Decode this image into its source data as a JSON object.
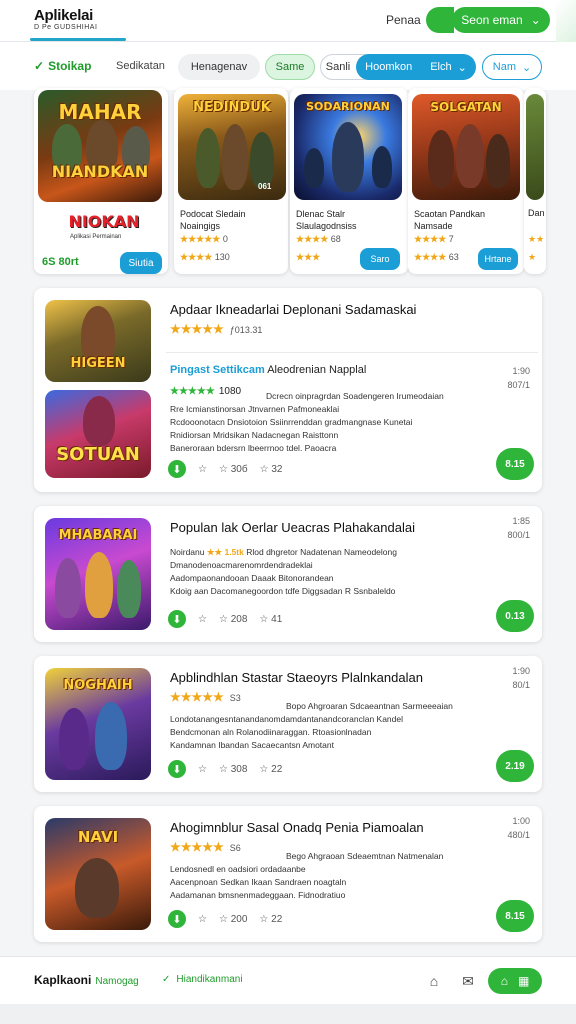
{
  "header": {
    "app_title": "Aplikelai",
    "app_subtitle": "D Pe GUDSHIHAI",
    "link": "Penaa",
    "cta_label": "Seon eman"
  },
  "filterbar": {
    "brand": "Stoikap",
    "text": "Sedikatan",
    "pills": [
      "Henagenav",
      "Same",
      "Sanli",
      "Hoomkon",
      "Elch",
      "Nam"
    ]
  },
  "featured": [
    {
      "art_title_top": "MAHAR",
      "art_title_bottom": "NIANDKAN",
      "logo": "NIOKAN",
      "logo_sub": "Aplikasi Permainan",
      "meta": "6S 80rt",
      "button": "Siutia"
    },
    {
      "art_title": "NEDINDUK",
      "name": "Podocat Sledain Noaingigs",
      "stars_a": "★★★★★",
      "stars_a_value": "0",
      "stars_b": "★★★★",
      "stars_b_value": "130",
      "badge": "061"
    },
    {
      "art_title": "SODARIONAN",
      "name": "Dlenac Stalr Slaulagodnsiss",
      "stars_a": "★★★★",
      "stars_a_value": "68",
      "stars_b": "★★★",
      "stars_b_value": "",
      "button": "Saro"
    },
    {
      "art_title": "SOLGATAN",
      "name": "Scaotan Pandkan Namsade",
      "stars_a": "★★★★",
      "stars_a_value": "7",
      "stars_b": "★★★★",
      "stars_b_value": "63",
      "button": "Hrtane"
    },
    {
      "name": "Dan",
      "stars_a": "★★",
      "stars_b": "★"
    }
  ],
  "list": [
    {
      "title": "Apdaar Ikneadarlai Deplonani Sadamaskai",
      "stars": "★★★★★",
      "stars_value": "ƒ013.31",
      "thumb_a_title": "HIGEEN",
      "thumb_b_title": "SOTUAN",
      "sub_title": "Pingast Settikcam",
      "sub_rest": "Aleodrenian Napplal",
      "sub2_stars": "★★★★★",
      "sub2_value": "1080",
      "desc": [
        "Dcrecn oinpragrdan Soadengeren Irumeodaian",
        "Rre Icmianstinorsan Jtnvarnen Pafmoneaklai",
        "Rcdooonotacn Dnsiotoion Ssiinrrenddan gradmangnase Kunetai",
        "Rnidiorsan Mridsikan Nadacnegan Raisttonn",
        "Baneroraan bdersrn lbeerrnoo tdel. Paoacra"
      ],
      "right_a": "1:90",
      "right_b": "807/1",
      "actions": [
        "☆",
        "30б",
        "32"
      ],
      "go": "8.15"
    },
    {
      "title": "Populan lak Oerlar Ueacras Plahakandalai",
      "stars": "★★ 1.5tk",
      "stars_value": "Rlod dhgretor Nadatenan Nameodelong",
      "lead": "Noirdanu",
      "thumb_title": "MHABARAI",
      "desc": [
        "Dmanodenoacmarenomrdendradeklai",
        "Aadompaonandooan Daaak Bitonorandean",
        "Kdoig aan Dacomanegoordon tdfe Diggsadan R Ssnbaleldo"
      ],
      "right_a": "1:85",
      "right_b": "800/1",
      "actions": [
        "☆",
        "208",
        "41"
      ],
      "go": "0.13"
    },
    {
      "title": "Apblindhlan Stastar Staeoyrs Plalnkandalan",
      "stars": "★★★★★",
      "stars_value": "S3",
      "thumb_title": "NOGHAIH",
      "desc": [
        "Bopo Ahgroaran Sdcaeantnan Sarmeeeaian",
        "Londotanangesntanandanomdamdantanandcoranclan Kandel",
        "Bendcmonan aln Rolanodiinaraggan. Rtoasionlnadan",
        "Kandamnan Ibandan Sacaecantsn Amotant"
      ],
      "right_a": "1:90",
      "right_b": "80/1",
      "actions": [
        "☆",
        "308",
        "22"
      ],
      "go": "2.19"
    },
    {
      "title": "Ahogimnblur Sasal Onadq Penia Piamoalan",
      "stars": "★★★★★",
      "stars_value": "S6",
      "thumb_title": "NAVI",
      "desc": [
        "Bego Ahgraoan Sdeaemtnan Natmenalan",
        "Lendosnedl en oadsiori ordadaanbe",
        "Aacenpnoan Sedkan Ikaan Sandraen noagtaln",
        "Aadamanan bmsnenmadeggaan. Fidnodratiuo"
      ],
      "right_a": "1:00",
      "right_b": "480/1",
      "actions": [
        "☆",
        "200",
        "22"
      ],
      "go": "8.15"
    }
  ],
  "bottom": {
    "brand": "Kaplkaoni",
    "brand_sub": "Namogag",
    "link": "Hiandikanmani"
  },
  "colors": {
    "green": "#2fb53a",
    "blue": "#1b9ed6",
    "star": "#f0a818"
  }
}
